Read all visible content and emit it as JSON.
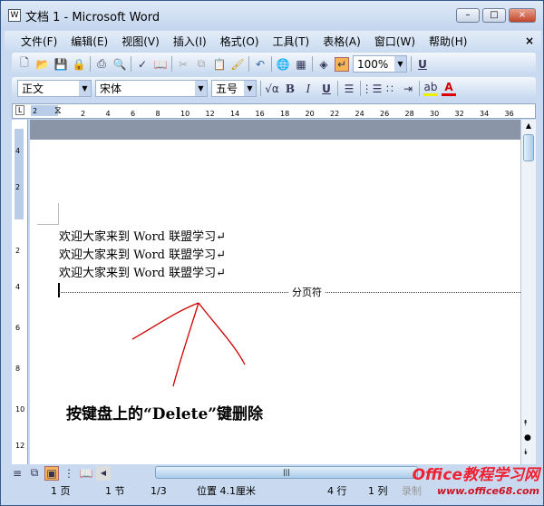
{
  "window": {
    "title": "文档 1 - Microsoft Word",
    "minimize": "–",
    "maximize": "□",
    "close": "×"
  },
  "menu": {
    "items": [
      "文件(F)",
      "编辑(E)",
      "视图(V)",
      "插入(I)",
      "格式(O)",
      "工具(T)",
      "表格(A)",
      "窗口(W)",
      "帮助(H)"
    ],
    "close": "×"
  },
  "toolbar": {
    "zoom": "100%"
  },
  "format": {
    "style": "正文",
    "font": "宋体",
    "size": "五号",
    "bold": "B",
    "italic": "I",
    "underline": "U",
    "font_color": "A"
  },
  "ruler": {
    "h_ticks": [
      "2",
      "2",
      "4",
      "6",
      "8",
      "10",
      "12",
      "14",
      "16",
      "18",
      "20",
      "22",
      "24",
      "26",
      "28",
      "30",
      "32",
      "34",
      "36"
    ],
    "v_ticks": [
      "4",
      "2",
      "2",
      "4",
      "6",
      "8",
      "10",
      "12"
    ],
    "tab_marker": "L"
  },
  "document": {
    "lines": [
      "欢迎大家来到 Word 联盟学习↵",
      "欢迎大家来到 Word 联盟学习↵",
      "欢迎大家来到 Word 联盟学习↵"
    ],
    "page_break": "分页符",
    "caption": "按键盘上的“Delete”键删除"
  },
  "status": {
    "page": "1 页",
    "section": "1 节",
    "pages": "1/3",
    "position": "位置 4.1厘米",
    "line": "4 行",
    "column": "1 列",
    "rec": "录制"
  },
  "watermark": {
    "title": "Office教程学习网",
    "url": "www.office68.com"
  }
}
